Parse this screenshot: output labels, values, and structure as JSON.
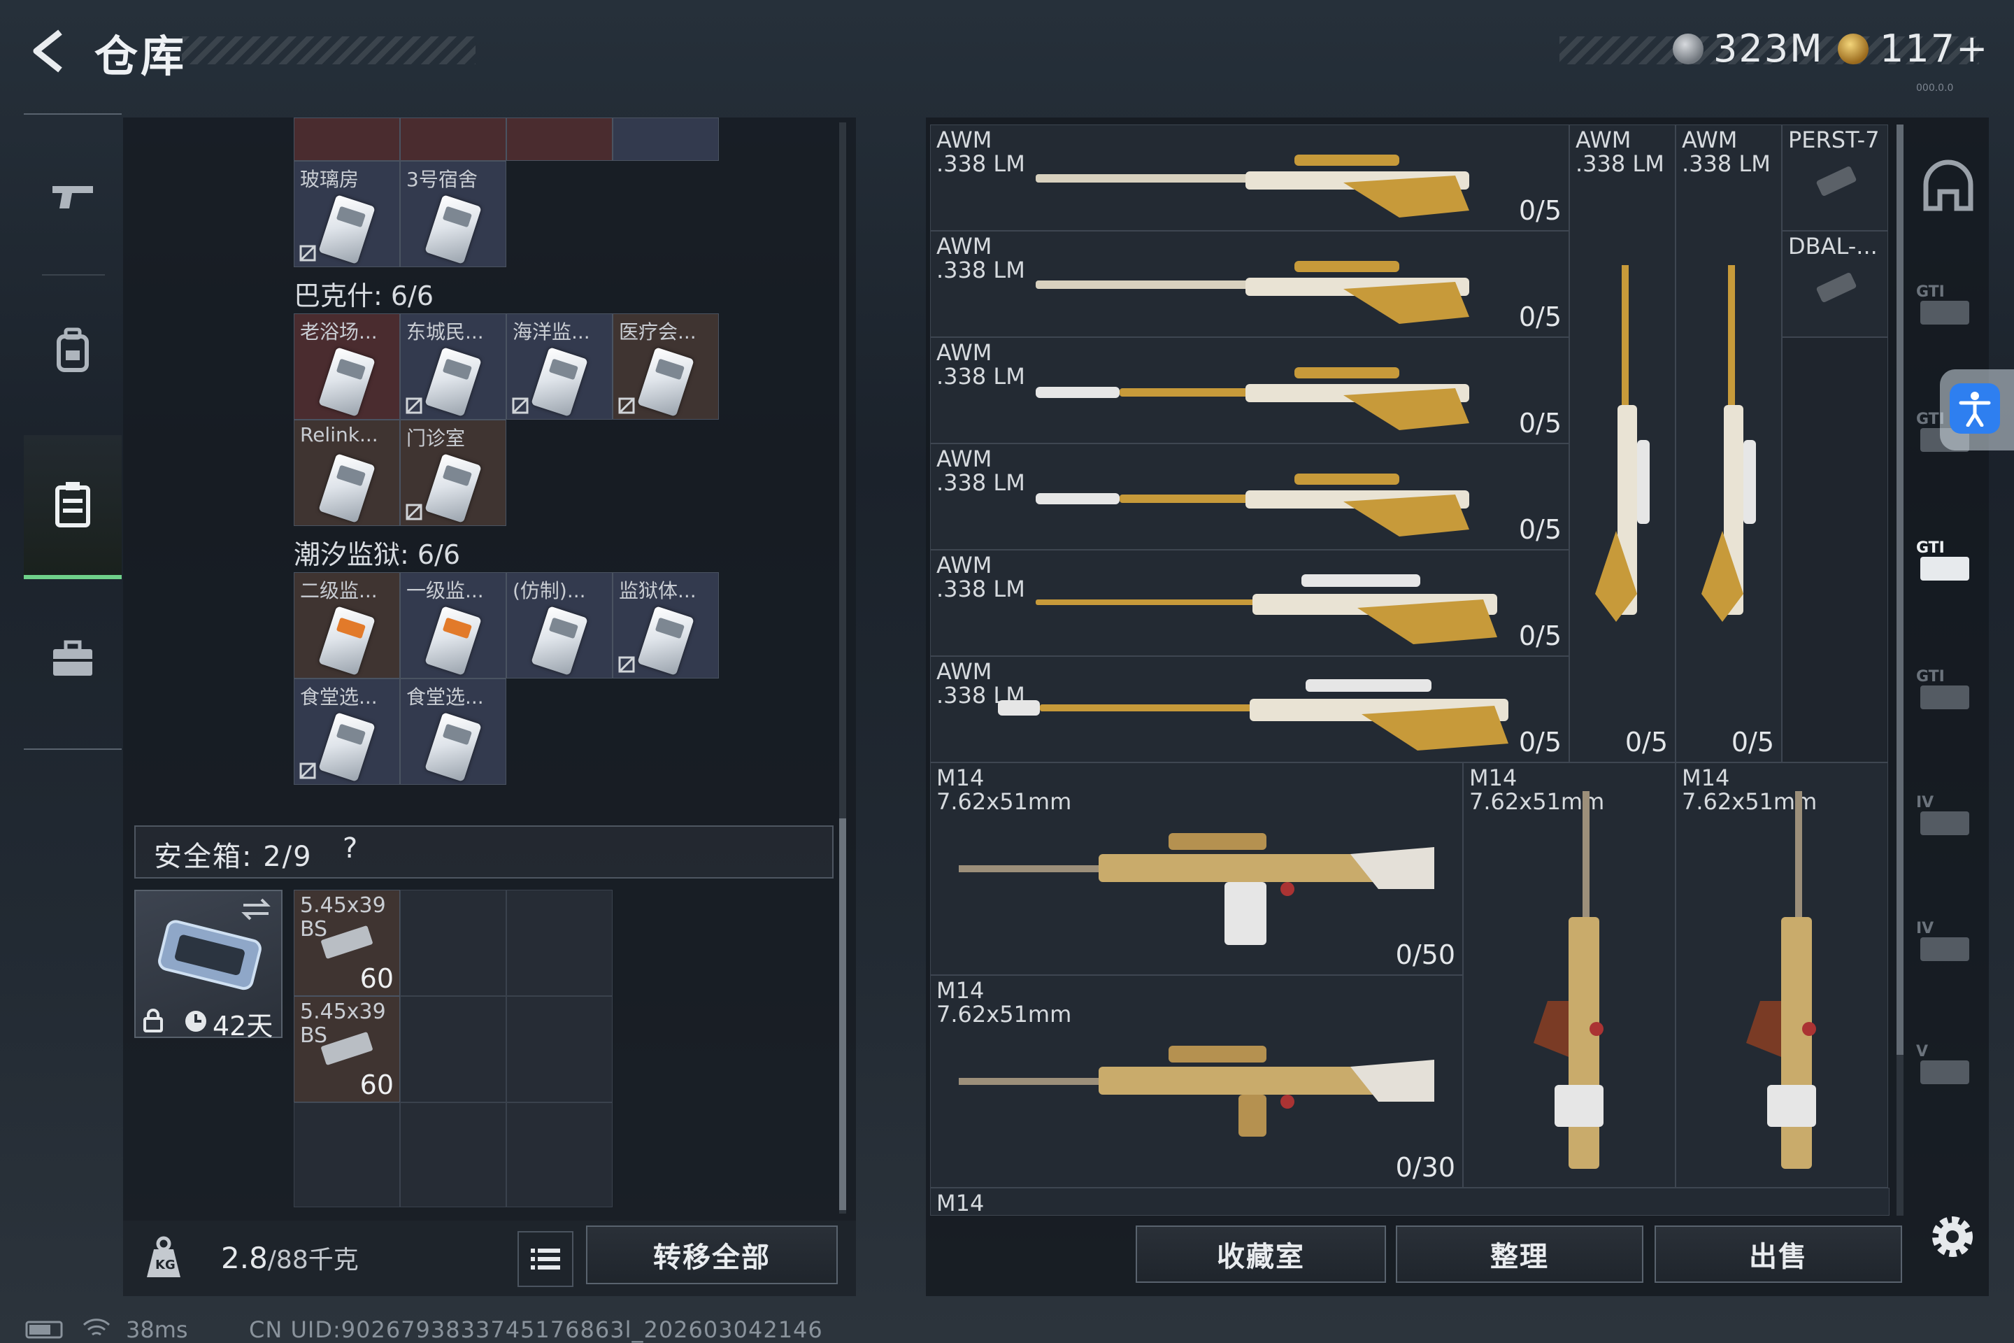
{
  "header": {
    "title": "仓库",
    "currency_silver": "323M",
    "currency_gold": "117+",
    "version": "000.0.0"
  },
  "left_nav": {
    "items": [
      "firearms",
      "backpack",
      "storage",
      "toolbox"
    ],
    "active": "storage"
  },
  "storage": {
    "top_cards": [
      "玻璃房",
      "3号宿舍"
    ],
    "section1_title": "巴克什: 6/6",
    "section1_cards": [
      "老浴场...",
      "东城民...",
      "海洋监...",
      "医疗会...",
      "Relink...",
      "门诊室"
    ],
    "section2_title": "潮汐监狱: 6/6",
    "section2_cards": [
      "二级监...",
      "一级监...",
      "(仿制)...",
      "监狱体...",
      "食堂选...",
      "食堂选..."
    ],
    "safe_box_label": "安全箱: 2/9",
    "safe_box_help": "?",
    "safe_box_timer": "42天",
    "ammo": [
      {
        "name": "5.45x39",
        "sub": "BS",
        "amount": "60"
      },
      {
        "name": "5.45x39",
        "sub": "BS",
        "amount": "60"
      }
    ],
    "weight_value": "2.8",
    "weight_max": "/88千克",
    "weight_icon_text": "KG",
    "transfer_all": "转移全部"
  },
  "weapons": {
    "awm_rows": [
      {
        "name": "AWM\n.338 LM",
        "count": "0/5"
      },
      {
        "name": "AWM\n.338 LM",
        "count": "0/5"
      },
      {
        "name": "AWM\n.338 LM",
        "count": "0/5"
      },
      {
        "name": "AWM\n.338 LM",
        "count": "0/5"
      },
      {
        "name": "AWM\n.338 LM",
        "count": "0/5"
      },
      {
        "name": "AWM\n.338 LM",
        "count": "0/5"
      }
    ],
    "awm_vertical": [
      {
        "name": "AWM\n.338 LM",
        "count": "0/5"
      },
      {
        "name": "AWM\n.338 LM",
        "count": "0/5"
      }
    ],
    "perst": "PERST-7",
    "dbal": "DBAL-...",
    "m14_rows": [
      {
        "name": "M14\n7.62x51mm",
        "count": "0/50"
      },
      {
        "name": "M14\n7.62x51mm",
        "count": "0/30"
      }
    ],
    "m14_vertical": [
      {
        "name": "M14\n7.62x51mm"
      },
      {
        "name": "M14\n7.62x51mm"
      }
    ],
    "m14_partial": "M14"
  },
  "right_nav": [
    "helmet-icon",
    "gti-armor-icon",
    "gti-armor-icon",
    "gti-armor-icon",
    "gti-armor-icon",
    "tier-iv-icon",
    "tier-iv-icon",
    "tier-v-icon"
  ],
  "actions": {
    "collection": "收藏室",
    "sort": "整理",
    "sell": "出售"
  },
  "status": {
    "ping": "38ms",
    "uid": "CN UID:9026793833745176863l_202603042146"
  },
  "colors": {
    "accent_green": "#6fd08a",
    "accessibility_blue": "#2e7ff0"
  }
}
